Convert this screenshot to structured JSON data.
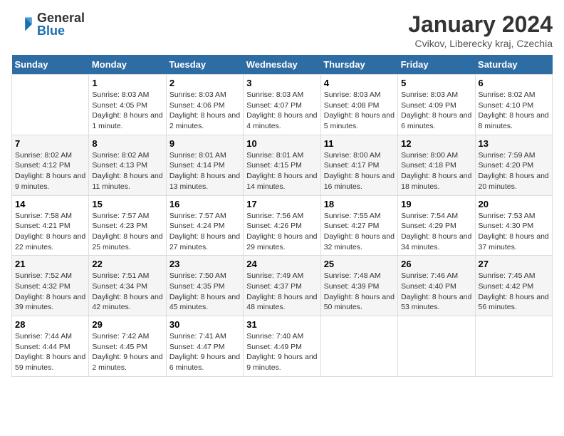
{
  "header": {
    "logo_general": "General",
    "logo_blue": "Blue",
    "title": "January 2024",
    "subtitle": "Cvikov, Liberecky kraj, Czechia"
  },
  "days_of_week": [
    "Sunday",
    "Monday",
    "Tuesday",
    "Wednesday",
    "Thursday",
    "Friday",
    "Saturday"
  ],
  "weeks": [
    [
      {
        "day": "",
        "sunrise": "",
        "sunset": "",
        "daylight": ""
      },
      {
        "day": "1",
        "sunrise": "Sunrise: 8:03 AM",
        "sunset": "Sunset: 4:05 PM",
        "daylight": "Daylight: 8 hours and 1 minute."
      },
      {
        "day": "2",
        "sunrise": "Sunrise: 8:03 AM",
        "sunset": "Sunset: 4:06 PM",
        "daylight": "Daylight: 8 hours and 2 minutes."
      },
      {
        "day": "3",
        "sunrise": "Sunrise: 8:03 AM",
        "sunset": "Sunset: 4:07 PM",
        "daylight": "Daylight: 8 hours and 4 minutes."
      },
      {
        "day": "4",
        "sunrise": "Sunrise: 8:03 AM",
        "sunset": "Sunset: 4:08 PM",
        "daylight": "Daylight: 8 hours and 5 minutes."
      },
      {
        "day": "5",
        "sunrise": "Sunrise: 8:03 AM",
        "sunset": "Sunset: 4:09 PM",
        "daylight": "Daylight: 8 hours and 6 minutes."
      },
      {
        "day": "6",
        "sunrise": "Sunrise: 8:02 AM",
        "sunset": "Sunset: 4:10 PM",
        "daylight": "Daylight: 8 hours and 8 minutes."
      }
    ],
    [
      {
        "day": "7",
        "sunrise": "Sunrise: 8:02 AM",
        "sunset": "Sunset: 4:12 PM",
        "daylight": "Daylight: 8 hours and 9 minutes."
      },
      {
        "day": "8",
        "sunrise": "Sunrise: 8:02 AM",
        "sunset": "Sunset: 4:13 PM",
        "daylight": "Daylight: 8 hours and 11 minutes."
      },
      {
        "day": "9",
        "sunrise": "Sunrise: 8:01 AM",
        "sunset": "Sunset: 4:14 PM",
        "daylight": "Daylight: 8 hours and 13 minutes."
      },
      {
        "day": "10",
        "sunrise": "Sunrise: 8:01 AM",
        "sunset": "Sunset: 4:15 PM",
        "daylight": "Daylight: 8 hours and 14 minutes."
      },
      {
        "day": "11",
        "sunrise": "Sunrise: 8:00 AM",
        "sunset": "Sunset: 4:17 PM",
        "daylight": "Daylight: 8 hours and 16 minutes."
      },
      {
        "day": "12",
        "sunrise": "Sunrise: 8:00 AM",
        "sunset": "Sunset: 4:18 PM",
        "daylight": "Daylight: 8 hours and 18 minutes."
      },
      {
        "day": "13",
        "sunrise": "Sunrise: 7:59 AM",
        "sunset": "Sunset: 4:20 PM",
        "daylight": "Daylight: 8 hours and 20 minutes."
      }
    ],
    [
      {
        "day": "14",
        "sunrise": "Sunrise: 7:58 AM",
        "sunset": "Sunset: 4:21 PM",
        "daylight": "Daylight: 8 hours and 22 minutes."
      },
      {
        "day": "15",
        "sunrise": "Sunrise: 7:57 AM",
        "sunset": "Sunset: 4:23 PM",
        "daylight": "Daylight: 8 hours and 25 minutes."
      },
      {
        "day": "16",
        "sunrise": "Sunrise: 7:57 AM",
        "sunset": "Sunset: 4:24 PM",
        "daylight": "Daylight: 8 hours and 27 minutes."
      },
      {
        "day": "17",
        "sunrise": "Sunrise: 7:56 AM",
        "sunset": "Sunset: 4:26 PM",
        "daylight": "Daylight: 8 hours and 29 minutes."
      },
      {
        "day": "18",
        "sunrise": "Sunrise: 7:55 AM",
        "sunset": "Sunset: 4:27 PM",
        "daylight": "Daylight: 8 hours and 32 minutes."
      },
      {
        "day": "19",
        "sunrise": "Sunrise: 7:54 AM",
        "sunset": "Sunset: 4:29 PM",
        "daylight": "Daylight: 8 hours and 34 minutes."
      },
      {
        "day": "20",
        "sunrise": "Sunrise: 7:53 AM",
        "sunset": "Sunset: 4:30 PM",
        "daylight": "Daylight: 8 hours and 37 minutes."
      }
    ],
    [
      {
        "day": "21",
        "sunrise": "Sunrise: 7:52 AM",
        "sunset": "Sunset: 4:32 PM",
        "daylight": "Daylight: 8 hours and 39 minutes."
      },
      {
        "day": "22",
        "sunrise": "Sunrise: 7:51 AM",
        "sunset": "Sunset: 4:34 PM",
        "daylight": "Daylight: 8 hours and 42 minutes."
      },
      {
        "day": "23",
        "sunrise": "Sunrise: 7:50 AM",
        "sunset": "Sunset: 4:35 PM",
        "daylight": "Daylight: 8 hours and 45 minutes."
      },
      {
        "day": "24",
        "sunrise": "Sunrise: 7:49 AM",
        "sunset": "Sunset: 4:37 PM",
        "daylight": "Daylight: 8 hours and 48 minutes."
      },
      {
        "day": "25",
        "sunrise": "Sunrise: 7:48 AM",
        "sunset": "Sunset: 4:39 PM",
        "daylight": "Daylight: 8 hours and 50 minutes."
      },
      {
        "day": "26",
        "sunrise": "Sunrise: 7:46 AM",
        "sunset": "Sunset: 4:40 PM",
        "daylight": "Daylight: 8 hours and 53 minutes."
      },
      {
        "day": "27",
        "sunrise": "Sunrise: 7:45 AM",
        "sunset": "Sunset: 4:42 PM",
        "daylight": "Daylight: 8 hours and 56 minutes."
      }
    ],
    [
      {
        "day": "28",
        "sunrise": "Sunrise: 7:44 AM",
        "sunset": "Sunset: 4:44 PM",
        "daylight": "Daylight: 8 hours and 59 minutes."
      },
      {
        "day": "29",
        "sunrise": "Sunrise: 7:42 AM",
        "sunset": "Sunset: 4:45 PM",
        "daylight": "Daylight: 9 hours and 2 minutes."
      },
      {
        "day": "30",
        "sunrise": "Sunrise: 7:41 AM",
        "sunset": "Sunset: 4:47 PM",
        "daylight": "Daylight: 9 hours and 6 minutes."
      },
      {
        "day": "31",
        "sunrise": "Sunrise: 7:40 AM",
        "sunset": "Sunset: 4:49 PM",
        "daylight": "Daylight: 9 hours and 9 minutes."
      },
      {
        "day": "",
        "sunrise": "",
        "sunset": "",
        "daylight": ""
      },
      {
        "day": "",
        "sunrise": "",
        "sunset": "",
        "daylight": ""
      },
      {
        "day": "",
        "sunrise": "",
        "sunset": "",
        "daylight": ""
      }
    ]
  ]
}
